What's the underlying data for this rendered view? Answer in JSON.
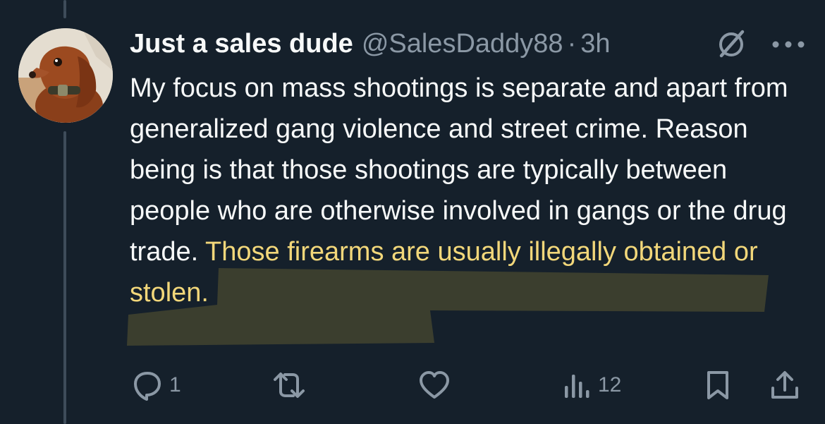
{
  "tweet": {
    "author": {
      "display_name": "Just a sales dude",
      "handle": "@SalesDaddy88",
      "separator": "·",
      "time": "3h"
    },
    "text_plain": "My focus on mass shootings is separate and apart from generalized gang violence and street crime. Reason being is that those shootings are typically between people who are otherwise involved in gangs or the drug trade.",
    "text_highlighted": "Those firearms are usually illegally obtained or stolen.",
    "highlight_color": "#f2d77a",
    "actions": {
      "reply_count": "1",
      "retweet_count": "",
      "like_count": "",
      "views_count": "12"
    }
  },
  "icons": {
    "avatar": "dog-avatar",
    "grok": "grok-icon",
    "more": "more-icon",
    "reply": "reply-icon",
    "retweet": "retweet-icon",
    "like": "heart-icon",
    "views": "views-icon",
    "bookmark": "bookmark-icon",
    "share": "share-icon"
  },
  "colors": {
    "background": "#15202b",
    "text": "#f7f9f9",
    "secondary": "#8b98a5",
    "thread_line": "#3e4c5a"
  }
}
